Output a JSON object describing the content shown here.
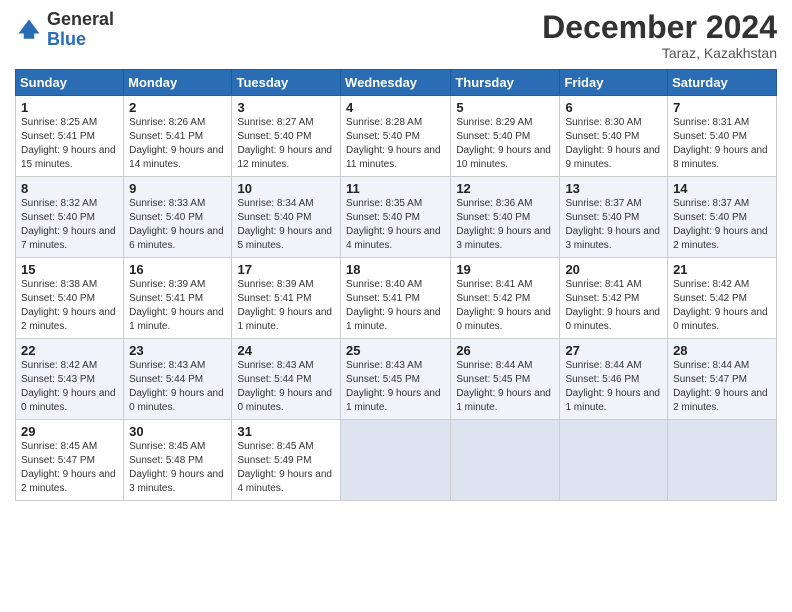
{
  "header": {
    "logo_general": "General",
    "logo_blue": "Blue",
    "month_title": "December 2024",
    "location": "Taraz, Kazakhstan"
  },
  "weekdays": [
    "Sunday",
    "Monday",
    "Tuesday",
    "Wednesday",
    "Thursday",
    "Friday",
    "Saturday"
  ],
  "weeks": [
    [
      {
        "num": "1",
        "info": "Sunrise: 8:25 AM\nSunset: 5:41 PM\nDaylight: 9 hours and 15 minutes."
      },
      {
        "num": "2",
        "info": "Sunrise: 8:26 AM\nSunset: 5:41 PM\nDaylight: 9 hours and 14 minutes."
      },
      {
        "num": "3",
        "info": "Sunrise: 8:27 AM\nSunset: 5:40 PM\nDaylight: 9 hours and 12 minutes."
      },
      {
        "num": "4",
        "info": "Sunrise: 8:28 AM\nSunset: 5:40 PM\nDaylight: 9 hours and 11 minutes."
      },
      {
        "num": "5",
        "info": "Sunrise: 8:29 AM\nSunset: 5:40 PM\nDaylight: 9 hours and 10 minutes."
      },
      {
        "num": "6",
        "info": "Sunrise: 8:30 AM\nSunset: 5:40 PM\nDaylight: 9 hours and 9 minutes."
      },
      {
        "num": "7",
        "info": "Sunrise: 8:31 AM\nSunset: 5:40 PM\nDaylight: 9 hours and 8 minutes."
      }
    ],
    [
      {
        "num": "8",
        "info": "Sunrise: 8:32 AM\nSunset: 5:40 PM\nDaylight: 9 hours and 7 minutes."
      },
      {
        "num": "9",
        "info": "Sunrise: 8:33 AM\nSunset: 5:40 PM\nDaylight: 9 hours and 6 minutes."
      },
      {
        "num": "10",
        "info": "Sunrise: 8:34 AM\nSunset: 5:40 PM\nDaylight: 9 hours and 5 minutes."
      },
      {
        "num": "11",
        "info": "Sunrise: 8:35 AM\nSunset: 5:40 PM\nDaylight: 9 hours and 4 minutes."
      },
      {
        "num": "12",
        "info": "Sunrise: 8:36 AM\nSunset: 5:40 PM\nDaylight: 9 hours and 3 minutes."
      },
      {
        "num": "13",
        "info": "Sunrise: 8:37 AM\nSunset: 5:40 PM\nDaylight: 9 hours and 3 minutes."
      },
      {
        "num": "14",
        "info": "Sunrise: 8:37 AM\nSunset: 5:40 PM\nDaylight: 9 hours and 2 minutes."
      }
    ],
    [
      {
        "num": "15",
        "info": "Sunrise: 8:38 AM\nSunset: 5:40 PM\nDaylight: 9 hours and 2 minutes."
      },
      {
        "num": "16",
        "info": "Sunrise: 8:39 AM\nSunset: 5:41 PM\nDaylight: 9 hours and 1 minute."
      },
      {
        "num": "17",
        "info": "Sunrise: 8:39 AM\nSunset: 5:41 PM\nDaylight: 9 hours and 1 minute."
      },
      {
        "num": "18",
        "info": "Sunrise: 8:40 AM\nSunset: 5:41 PM\nDaylight: 9 hours and 1 minute."
      },
      {
        "num": "19",
        "info": "Sunrise: 8:41 AM\nSunset: 5:42 PM\nDaylight: 9 hours and 0 minutes."
      },
      {
        "num": "20",
        "info": "Sunrise: 8:41 AM\nSunset: 5:42 PM\nDaylight: 9 hours and 0 minutes."
      },
      {
        "num": "21",
        "info": "Sunrise: 8:42 AM\nSunset: 5:42 PM\nDaylight: 9 hours and 0 minutes."
      }
    ],
    [
      {
        "num": "22",
        "info": "Sunrise: 8:42 AM\nSunset: 5:43 PM\nDaylight: 9 hours and 0 minutes."
      },
      {
        "num": "23",
        "info": "Sunrise: 8:43 AM\nSunset: 5:44 PM\nDaylight: 9 hours and 0 minutes."
      },
      {
        "num": "24",
        "info": "Sunrise: 8:43 AM\nSunset: 5:44 PM\nDaylight: 9 hours and 0 minutes."
      },
      {
        "num": "25",
        "info": "Sunrise: 8:43 AM\nSunset: 5:45 PM\nDaylight: 9 hours and 1 minute."
      },
      {
        "num": "26",
        "info": "Sunrise: 8:44 AM\nSunset: 5:45 PM\nDaylight: 9 hours and 1 minute."
      },
      {
        "num": "27",
        "info": "Sunrise: 8:44 AM\nSunset: 5:46 PM\nDaylight: 9 hours and 1 minute."
      },
      {
        "num": "28",
        "info": "Sunrise: 8:44 AM\nSunset: 5:47 PM\nDaylight: 9 hours and 2 minutes."
      }
    ],
    [
      {
        "num": "29",
        "info": "Sunrise: 8:45 AM\nSunset: 5:47 PM\nDaylight: 9 hours and 2 minutes."
      },
      {
        "num": "30",
        "info": "Sunrise: 8:45 AM\nSunset: 5:48 PM\nDaylight: 9 hours and 3 minutes."
      },
      {
        "num": "31",
        "info": "Sunrise: 8:45 AM\nSunset: 5:49 PM\nDaylight: 9 hours and 4 minutes."
      },
      null,
      null,
      null,
      null
    ]
  ]
}
